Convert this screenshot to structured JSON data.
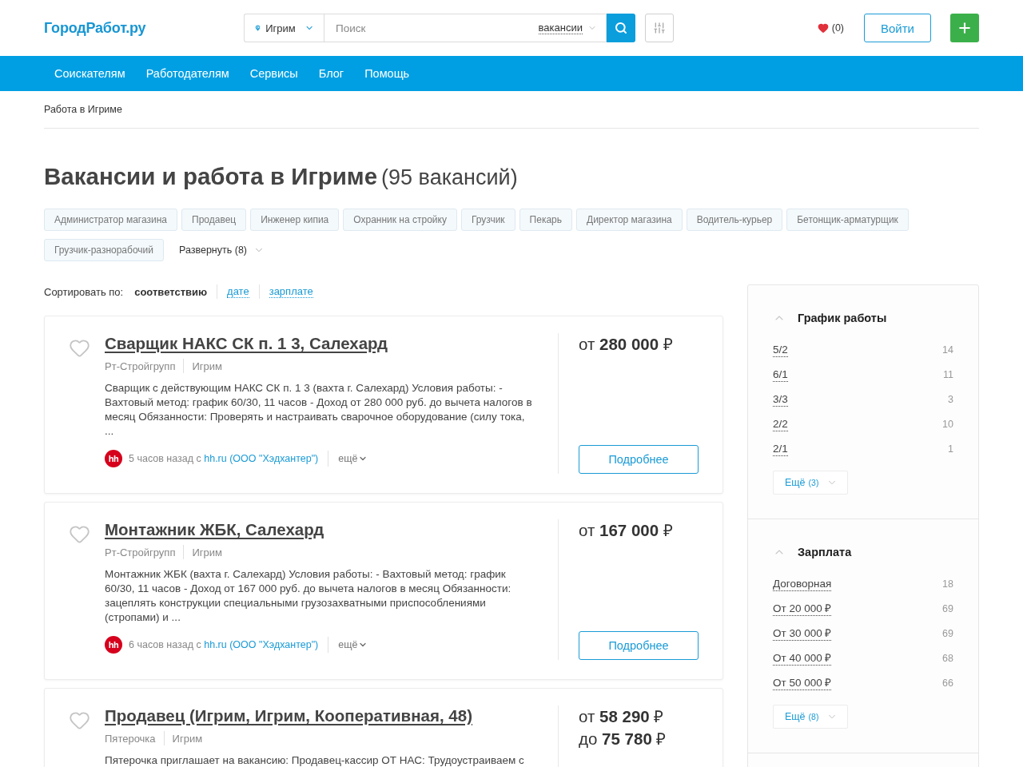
{
  "header": {
    "logo": "ГородРабот.ру",
    "location": "Игрим",
    "search": {
      "placeholder": "Поиск",
      "scope": "вакансии"
    },
    "favorites": "(0)",
    "login": "Войти"
  },
  "nav": [
    "Соискателям",
    "Работодателям",
    "Сервисы",
    "Блог",
    "Помощь"
  ],
  "breadcrumb": "Работа в Игриме",
  "heading": {
    "title": "Вакансии и работа в Игриме",
    "count": "(95 вакансий)"
  },
  "tags": [
    "Администратор магазина",
    "Продавец",
    "Инженер кипиа",
    "Охранник на стройку",
    "Грузчик",
    "Пекарь",
    "Директор магазина",
    "Водитель-курьер",
    "Бетонщик-арматурщик",
    "Грузчик-разнорабочий"
  ],
  "tags_toggle": {
    "label": "Развернуть (8)",
    "expanded": false
  },
  "sort": {
    "label": "Сортировать по:",
    "options": [
      {
        "label": "соответствию",
        "selected": true
      },
      {
        "label": "дате",
        "selected": false
      },
      {
        "label": "зарплате",
        "selected": false
      }
    ]
  },
  "vacancies": [
    {
      "title": "Сварщик НАКС СК п. 1 3, Салехард",
      "favorite": false,
      "company": "Рт-Стройгрупп",
      "city": "Игрим",
      "description": "Сварщик с действующим НАКС СК п. 1 3 (вахта г. Салехард) Условия работы: - Вахтовый метод: график 60/30, 11 часов - Доход от 280 000 руб. до вычета налогов в месяц Обязанности: Проверять и настраивать сварочное оборудование (силу тока, ...",
      "source": {
        "logo": "hh",
        "posted": "5 часов назад с ",
        "link": "hh.ru (ООО \"Хэдхантер\")",
        "more": "ещё"
      },
      "salary": [
        {
          "prefix": "от",
          "amount": "280 000",
          "currency": "₽"
        }
      ],
      "button": "Подробнее"
    },
    {
      "title": "Монтажник ЖБК, Салехард",
      "favorite": false,
      "company": "Рт-Стройгрупп",
      "city": "Игрим",
      "description": "Монтажник ЖБК (вахта г. Салехард) Условия работы: - Вахтовый метод: график 60/30, 11 часов - Доход от 167 000 руб. до вычета налогов в месяц Обязанности: зацеплять конструкции специальными грузозахватными приспособлениями (стропами) и ...",
      "source": {
        "logo": "hh",
        "posted": "6 часов назад с ",
        "link": "hh.ru (ООО \"Хэдхантер\")",
        "more": "ещё"
      },
      "salary": [
        {
          "prefix": "от",
          "amount": "167 000",
          "currency": "₽"
        }
      ],
      "button": "Подробнее"
    },
    {
      "title": "Продавец (Игрим, Игрим, Кооперативная, 48)",
      "favorite": false,
      "company": "Пятерочка",
      "city": "Игрим",
      "description": "Пятерочка приглашает на вакансию: Продавец-кассир ОТ НАС: Трудоустраиваем с",
      "salary": [
        {
          "prefix": "от",
          "amount": "58 290",
          "currency": "₽"
        },
        {
          "prefix": "до",
          "amount": "75 780",
          "currency": "₽"
        }
      ]
    }
  ],
  "filters": [
    {
      "title": "График работы",
      "expanded": true,
      "options": [
        {
          "label": "5/2",
          "count": "14"
        },
        {
          "label": "6/1",
          "count": "11"
        },
        {
          "label": "3/3",
          "count": "3"
        },
        {
          "label": "2/2",
          "count": "10"
        },
        {
          "label": "2/1",
          "count": "1"
        }
      ],
      "more": {
        "label": "Ещё",
        "count": "(3)"
      }
    },
    {
      "title": "Зарплата",
      "expanded": true,
      "options": [
        {
          "label": "Договорная",
          "count": "18"
        },
        {
          "label": "От 20 000 ₽",
          "count": "69"
        },
        {
          "label": "От 30 000 ₽",
          "count": "69"
        },
        {
          "label": "От 40 000 ₽",
          "count": "68"
        },
        {
          "label": "От 50 000 ₽",
          "count": "66"
        }
      ],
      "more": {
        "label": "Ещё",
        "count": "(8)"
      }
    }
  ]
}
